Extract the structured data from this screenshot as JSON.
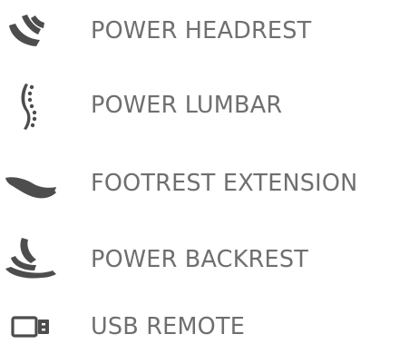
{
  "theme": {
    "icon_color": "#4d4d4d",
    "label_color": "#6f6f6f"
  },
  "features": [
    {
      "label": "POWER HEADREST",
      "icon": "headrest-icon"
    },
    {
      "label": "POWER LUMBAR",
      "icon": "lumbar-icon"
    },
    {
      "label": "FOOTREST EXTENSION",
      "icon": "footrest-icon"
    },
    {
      "label": "POWER BACKREST",
      "icon": "backrest-icon"
    },
    {
      "label": "USB REMOTE",
      "icon": "usb-remote-icon"
    }
  ]
}
